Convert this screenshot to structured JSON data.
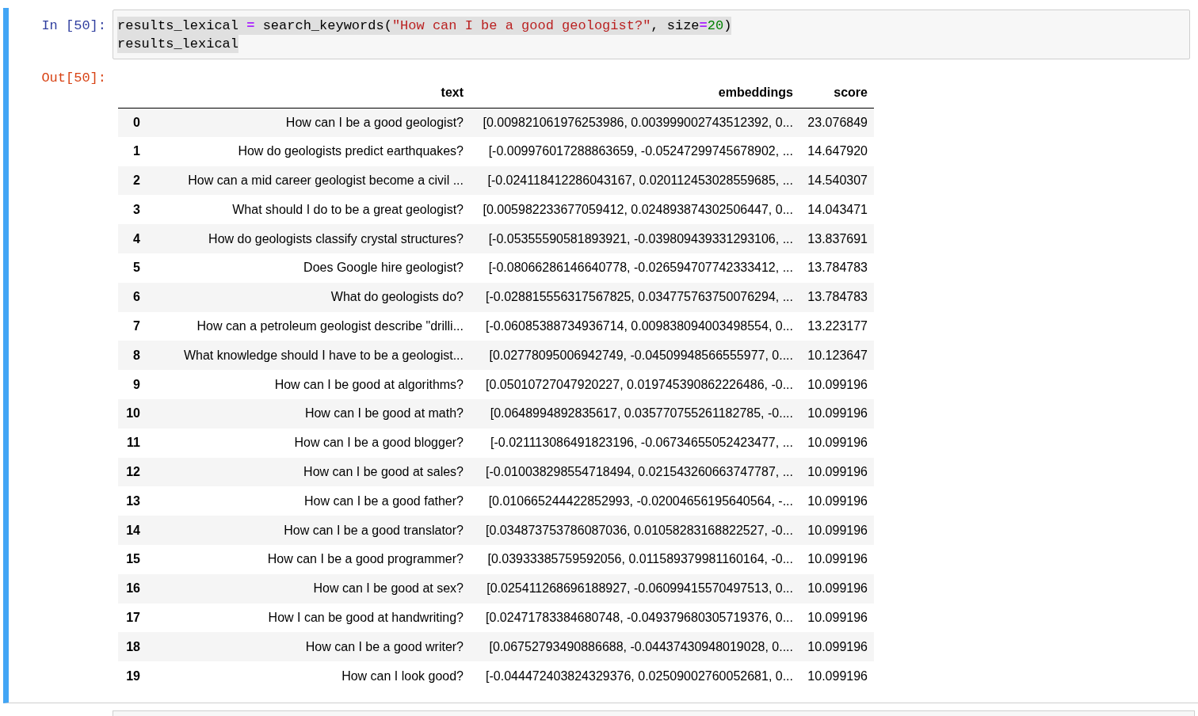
{
  "input_cell": {
    "prompt": "In [50]:",
    "lines": [
      [
        {
          "kind": "name",
          "text": "results_lexical "
        },
        {
          "kind": "op",
          "text": "="
        },
        {
          "kind": "name",
          "text": " search_keywords("
        },
        {
          "kind": "string",
          "text": "\"How can I be a good geologist?\""
        },
        {
          "kind": "name",
          "text": ", size"
        },
        {
          "kind": "op",
          "text": "="
        },
        {
          "kind": "number",
          "text": "20"
        },
        {
          "kind": "name",
          "text": ")"
        }
      ],
      [
        {
          "kind": "name",
          "text": "results_lexical"
        }
      ]
    ]
  },
  "output_cell": {
    "prompt": "Out[50]:",
    "table": {
      "columns": [
        "",
        "text",
        "embeddings",
        "score"
      ],
      "rows": [
        [
          "0",
          "How can I be a good geologist?",
          "[0.009821061976253986, 0.003999002743512392, 0...",
          "23.076849"
        ],
        [
          "1",
          "How do geologists predict earthquakes?",
          "[-0.009976017288863659, -0.05247299745678902, ...",
          "14.647920"
        ],
        [
          "2",
          "How can a mid career geologist become a civil ...",
          "[-0.024118412286043167, 0.020112453028559685, ...",
          "14.540307"
        ],
        [
          "3",
          "What should I do to be a great geologist?",
          "[0.005982233677059412, 0.024893874302506447, 0...",
          "14.043471"
        ],
        [
          "4",
          "How do geologists classify crystal structures?",
          "[-0.05355590581893921, -0.039809439331293106, ...",
          "13.837691"
        ],
        [
          "5",
          "Does Google hire geologist?",
          "[-0.08066286146640778, -0.026594707742333412, ...",
          "13.784783"
        ],
        [
          "6",
          "What do geologists do?",
          "[-0.028815556317567825, 0.034775763750076294, ...",
          "13.784783"
        ],
        [
          "7",
          "How can a petroleum geologist describe \"drilli...",
          "[-0.06085388734936714, 0.009838094003498554, 0...",
          "13.223177"
        ],
        [
          "8",
          "What knowledge should I have to be a geologist...",
          "[0.02778095006942749, -0.04509948566555977, 0....",
          "10.123647"
        ],
        [
          "9",
          "How can I be good at algorithms?",
          "[0.05010727047920227, 0.019745390862226486, -0...",
          "10.099196"
        ],
        [
          "10",
          "How can I be good at math?",
          "[0.0648994892835617, 0.035770755261182785, -0....",
          "10.099196"
        ],
        [
          "11",
          "How can I be a good blogger?",
          "[-0.021113086491823196, -0.06734655052423477, ...",
          "10.099196"
        ],
        [
          "12",
          "How can I be good at sales?",
          "[-0.010038298554718494, 0.021543260663747787, ...",
          "10.099196"
        ],
        [
          "13",
          "How can I be a good father?",
          "[0.010665244422852993, -0.02004656195640564, -...",
          "10.099196"
        ],
        [
          "14",
          "How can I be a good translator?",
          "[0.034873753786087036, 0.01058283168822527, -0...",
          "10.099196"
        ],
        [
          "15",
          "How can I be a good programmer?",
          "[0.03933385759592056, 0.011589379981160164, -0...",
          "10.099196"
        ],
        [
          "16",
          "How can I be good at sex?",
          "[0.025411268696188927, -0.06099415570497513, 0...",
          "10.099196"
        ],
        [
          "17",
          "How I can be good at handwriting?",
          "[0.02471783384680748, -0.049379680305719376, 0...",
          "10.099196"
        ],
        [
          "18",
          "How can I be a good writer?",
          "[0.06752793490886688, -0.04437430948019028, 0....",
          "10.099196"
        ],
        [
          "19",
          "How can I look good?",
          "[-0.044472403824329376, 0.02509002760052681, 0...",
          "10.099196"
        ]
      ]
    }
  }
}
